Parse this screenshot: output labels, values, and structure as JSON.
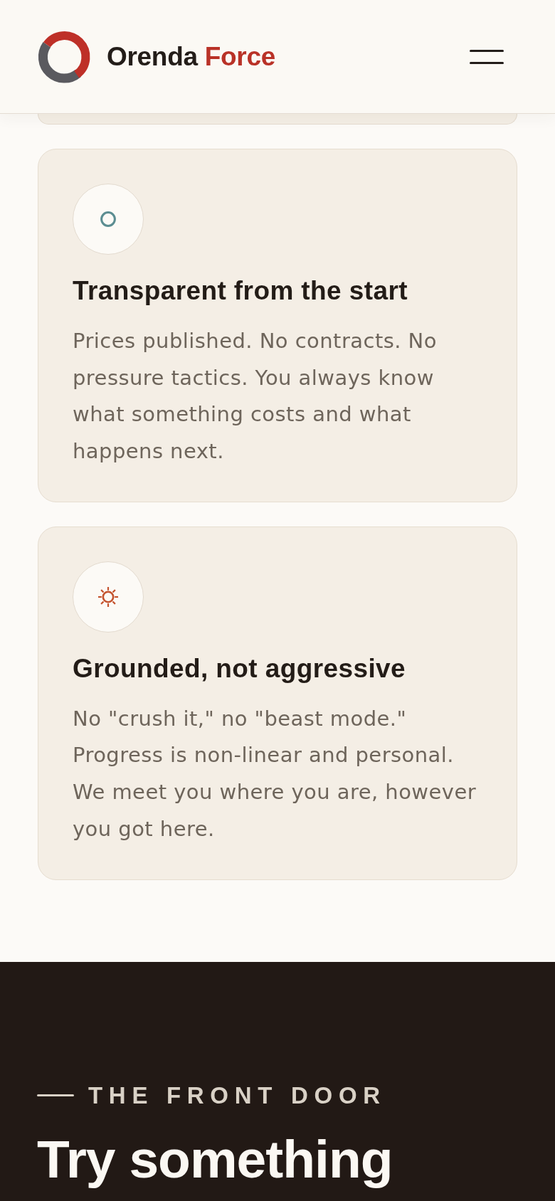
{
  "header": {
    "brand": {
      "name": "Orenda",
      "accent": "Force"
    }
  },
  "values": [
    {
      "kind": "ring",
      "color": "#5b8d91",
      "title": "Transparent from the start",
      "body": "Prices published. No contracts. No pressure tactics. You always know what something costs and what happens next."
    },
    {
      "kind": "sun",
      "color": "#c4532e",
      "title": "Grounded, not aggressive",
      "body": "No \"crush it,\" no \"beast mode.\" Progress is non-linear and personal. We meet you where you are, however you got here."
    }
  ],
  "cta": {
    "eyebrow": "THE FRONT DOOR",
    "headline": "Try something"
  }
}
